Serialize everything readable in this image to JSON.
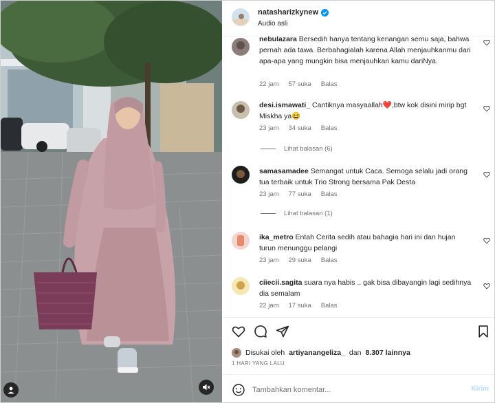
{
  "header": {
    "username": "natasharizkynew",
    "subtitle": "Audio asli",
    "more_icon": "more-horizontal-icon"
  },
  "comments": [
    {
      "user": "nebulazara",
      "text": "Bersedih hanya tentang kenangan semu saja, bahwa pernah ada tawa. Berbahagialah karena Allah menjauhkanmu dari apa-apa yang mungkin bisa menjauhkan kamu dariNya.",
      "time": "22 jam",
      "likes": "57 suka",
      "reply": "Balas"
    },
    {
      "user": "desi.ismawati_",
      "text": "Cantiknya masyaallah❤️,btw kok disini mirip bgt Miskha ya😆",
      "time": "23 jam",
      "likes": "34 suka",
      "reply": "Balas",
      "view_replies": "Lihat balasan (6)"
    },
    {
      "user": "samasamadee",
      "text": "Semangat untuk Caca. Semoga selalu jadi orang tua terbaik untuk Trio Strong bersama Pak Desta",
      "time": "23 jam",
      "likes": "77 suka",
      "reply": "Balas",
      "view_replies": "Lihat balasan (1)"
    },
    {
      "user": "ika_metro",
      "text": "Entah Cerita sedih atau bahagia hari ini dan hujan turun menunggu pelangi",
      "time": "23 jam",
      "likes": "29 suka",
      "reply": "Balas"
    },
    {
      "user": "ciiecii.sagita",
      "text": "suara nya habis .. gak bisa dibayangin lagi sedihnya dia semalam",
      "time": "22 jam",
      "likes": "17 suka",
      "reply": "Balas"
    }
  ],
  "actions": {
    "like_icon": "heart-icon",
    "comment_icon": "comment-bubble-icon",
    "share_icon": "paper-plane-icon",
    "save_icon": "bookmark-icon"
  },
  "likes": {
    "prefix": "Disukai oleh",
    "user": "artiyanangeliza_",
    "joiner": "dan",
    "count": "8.307 lainnya"
  },
  "post_date": "1 HARI YANG LALU",
  "add_comment": {
    "placeholder": "Tambahkan komentar...",
    "post_label": "Kirim"
  },
  "colors": {
    "text": "#262626",
    "secondary": "#737373",
    "link_disabled": "#b3dbff",
    "verified": "#0095f6"
  }
}
